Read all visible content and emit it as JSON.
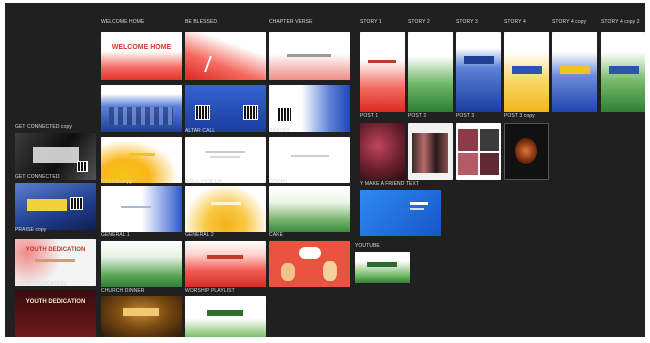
{
  "canvas": {
    "background": "#202020"
  },
  "frames": {
    "welcome_home": {
      "label": "WELCOME HOME",
      "title": "WELCOME HOME"
    },
    "be_blessed": {
      "label": "BE BLESSED"
    },
    "chapter_verse": {
      "label": "CHAPTER VERSE"
    },
    "al_call": {
      "label": "ALTAR CALL"
    },
    "prayer": {
      "label": "PRAYER"
    },
    "get_connected_copy": {
      "label": "GET CONNECTED copy"
    },
    "get_connected": {
      "label": "GET CONNECTED"
    },
    "praise": {
      "label": "PRAISE"
    },
    "bible_pick_up": {
      "label": "BIBLE PICK-UP"
    },
    "godpk": {
      "label": "GODPK"
    },
    "praise_copy": {
      "label": "PRAISE copy"
    },
    "general_1": {
      "label": "GENERAL 1"
    },
    "general_2": {
      "label": "GENERAL 2"
    },
    "cake": {
      "label": "CAKE"
    },
    "church_dinner": {
      "label": "CHURCH DINNER"
    },
    "worship_playlist": {
      "label": "WORSHIP PLAYLIST"
    },
    "youth_dedication_1": {
      "title": "YOUTH DEDICATION"
    },
    "youth_dedication_2": {
      "title": "YOUTH DEDICATION"
    },
    "story_1": {
      "label": "STORY 1"
    },
    "story_2": {
      "label": "STORY 2"
    },
    "story_3": {
      "label": "STORY 3"
    },
    "story_4": {
      "label": "STORY 4"
    },
    "story_4_copy": {
      "label": "STORY 4 copy"
    },
    "story_4_copy_2": {
      "label": "STORY 4 copy 2"
    },
    "post_1": {
      "label": "POST 1"
    },
    "post_2": {
      "label": "POST 2"
    },
    "post_3": {
      "label": "POST 3"
    },
    "post_3_copy": {
      "label": "POST 3 copy"
    },
    "make_a_friend": {
      "label": "Y MAKE A FRIEND TEXT"
    },
    "youtube": {
      "label": "YOUTUBE"
    }
  }
}
